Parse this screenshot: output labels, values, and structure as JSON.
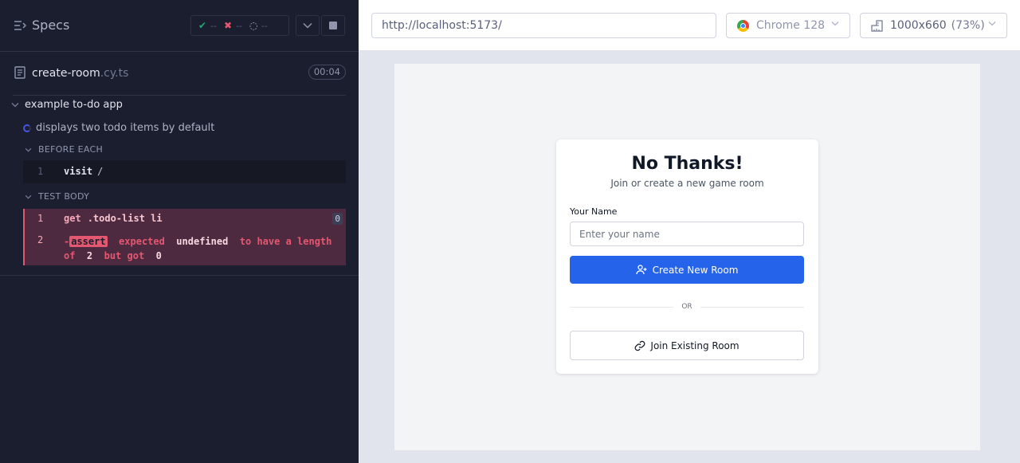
{
  "reporter": {
    "specs_label": "Specs",
    "stats": {
      "passed": "--",
      "failed": "--",
      "pending": "--"
    },
    "file": {
      "name": "create-room",
      "ext": ".cy.ts",
      "duration": "00:04"
    },
    "suite_title": "example to-do app",
    "test_title": "displays two todo items by default",
    "before_each_label": "BEFORE EACH",
    "visit_cmd": {
      "num": "1",
      "name": "visit",
      "arg": "/"
    },
    "test_body_label": "TEST BODY",
    "get_cmd": {
      "num": "1",
      "name": "get",
      "arg": ".todo-list li",
      "count": "0"
    },
    "assert_cmd": {
      "num": "2",
      "prefix": "-",
      "tag": "assert",
      "w1": "expected",
      "w2": "undefined",
      "w3": "to have a length of",
      "w4": "2",
      "w5": "but got",
      "w6": "0"
    }
  },
  "aut": {
    "url": "http://localhost:5173/",
    "browser": "Chrome 128",
    "viewport": "1000x660",
    "zoom": "(73%)"
  },
  "app": {
    "title": "No Thanks!",
    "subtitle": "Join or create a new game room",
    "name_label": "Your Name",
    "name_placeholder": "Enter your name",
    "create_label": "Create New Room",
    "or_label": "OR",
    "join_label": "Join Existing Room"
  },
  "colors": {
    "reporter_bg": "#1b1e2e",
    "fail": "#e45770",
    "pass": "#1fa971",
    "primary_button": "#2563eb"
  }
}
